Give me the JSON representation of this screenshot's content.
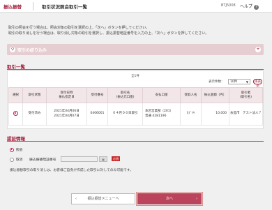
{
  "header": {
    "breadcrumb": "振込振替",
    "title": "取引状況照会取引一覧",
    "screen_code": "BTJ5008",
    "help_label": "ヘルプ",
    "help_icon": "?"
  },
  "intro": [
    "取引の照会を行う場合は、照会対象の取引を選択の上、「次へ」ボタンを押してください。",
    "取引の取り消しを行う場合は、取り消し対象の取引を選択し、振込振替暗証番号を入力の上、「次へ」ボタンを押してください。"
  ],
  "filter": {
    "label": "取引の絞り込み",
    "icon": "search-icon",
    "toggle": "+"
  },
  "list": {
    "section_title": "取引一覧",
    "count": "全1件",
    "per_page_label": "表示件数：",
    "per_page_value": "10件",
    "redisplay_label": "再表示",
    "columns": [
      "選択",
      "取引状態",
      "受付日時\n振込指定日",
      "受付番号",
      "取引名\n(振込元口座)",
      "支払口座",
      "受取人名",
      "振込金額（円）",
      "取引者\n(取引名)"
    ],
    "rows": [
      {
        "status": "受付済み",
        "dates": [
          "2021年04月06日",
          "2021年04月07日"
        ],
        "receipt_no": "0406001",
        "trade_name": "０４月０６日取引",
        "account": [
          "本店営業部（201）",
          "普通 4281196"
        ],
        "payee": "ｶﾌﾞｼｷ",
        "amount": "10,000",
        "trader": "糸島市　テスト法人７"
      }
    ]
  },
  "auth": {
    "section_title": "認証情報",
    "option_inquiry": "照会",
    "option_cancel": "取消",
    "pin_label": "振込振替暗証番号",
    "keyboard_label": "▦",
    "required_label": "必須",
    "note": "振込振替取引の取り消しは、お客様ご自身が作成した取引に対してのみ可能です。"
  },
  "buttons": {
    "back_label": "振込振替メニューへ",
    "back_chevron": "‹",
    "next_label": "次へ",
    "next_chevron": "›"
  },
  "colors": {
    "accent": "#a01c3a",
    "button": "#b9445b",
    "filter_bar": "#e5cdd1"
  }
}
